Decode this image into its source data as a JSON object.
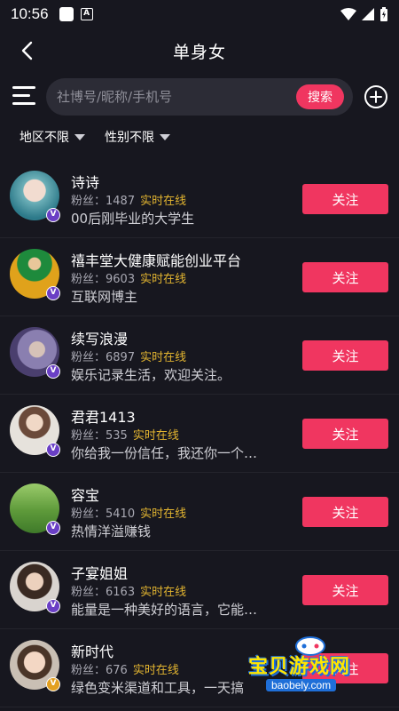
{
  "status_bar": {
    "time": "10:56",
    "a_label": "A"
  },
  "header": {
    "title": "单身女"
  },
  "search": {
    "placeholder": "社博号/昵称/手机号",
    "button_label": "搜索"
  },
  "filters": [
    {
      "label": "地区不限"
    },
    {
      "label": "性别不限"
    }
  ],
  "users": [
    {
      "name": "诗诗",
      "fans_label": "粉丝：1487",
      "status": "实时在线",
      "bio": "00后刚毕业的大学生",
      "follow_label": "关注",
      "badge": "V"
    },
    {
      "name": "禧丰堂大健康赋能创业平台",
      "fans_label": "粉丝：9603",
      "status": "实时在线",
      "bio": "互联网博主",
      "follow_label": "关注",
      "badge": "V"
    },
    {
      "name": "续写浪漫",
      "fans_label": "粉丝：6897",
      "status": "实时在线",
      "bio": "娱乐记录生活，欢迎关注。",
      "follow_label": "关注",
      "badge": "V"
    },
    {
      "name": "君君1413",
      "fans_label": "粉丝：535",
      "status": "实时在线",
      "bio": "你给我一份信任，我还你一个…",
      "follow_label": "关注",
      "badge": "V"
    },
    {
      "name": "容宝",
      "fans_label": "粉丝：5410",
      "status": "实时在线",
      "bio": "热情洋溢赚钱",
      "follow_label": "关注",
      "badge": "V"
    },
    {
      "name": "子宴姐姐",
      "fans_label": "粉丝：6163",
      "status": "实时在线",
      "bio": "能量是一种美好的语言，它能…",
      "follow_label": "关注",
      "badge": "V"
    },
    {
      "name": "新时代",
      "fans_label": "粉丝：676",
      "status": "实时在线",
      "bio": "绿色变米渠道和工具，一天搞",
      "follow_label": "关注",
      "badge": "V"
    }
  ],
  "watermark": {
    "text": "宝贝游戏网",
    "url": "baobely.com"
  },
  "colors": {
    "background": "#17171f",
    "accent": "#f03660",
    "online": "#e3b530",
    "badge": "#6a3fc5"
  }
}
